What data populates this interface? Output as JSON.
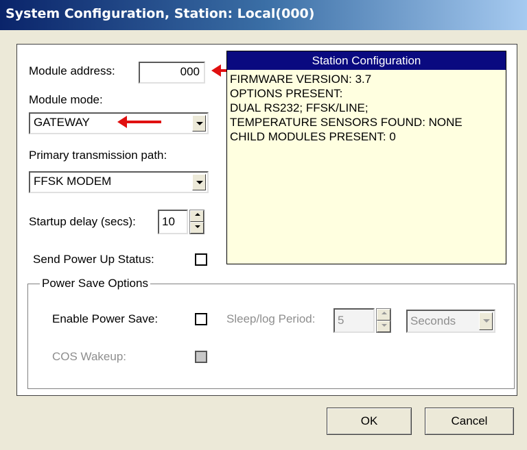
{
  "window": {
    "title": "System Configuration, Station: Local(000)"
  },
  "form": {
    "module_address_label": "Module address:",
    "module_address_value": "000",
    "module_mode_label": "Module mode:",
    "module_mode_value": "GATEWAY",
    "primary_path_label": "Primary transmission path:",
    "primary_path_value": "FFSK MODEM",
    "startup_delay_label": "Startup delay (secs):",
    "startup_delay_value": "10",
    "send_power_up_label": "Send Power Up Status:",
    "send_power_up_checked": false
  },
  "station_config": {
    "title": "Station Configuration",
    "lines": [
      "FIRMWARE VERSION: 3.7",
      "OPTIONS PRESENT:",
      "DUAL RS232; FFSK/LINE;",
      "TEMPERATURE SENSORS FOUND:  NONE",
      "CHILD MODULES PRESENT: 0"
    ]
  },
  "power_save": {
    "group_title": "Power Save Options",
    "enable_label": "Enable Power Save:",
    "enable_checked": false,
    "sleep_label": "Sleep/log Period:",
    "sleep_value": "5",
    "sleep_unit": "Seconds",
    "cos_label": "COS Wakeup:",
    "cos_checked": false
  },
  "buttons": {
    "ok": "OK",
    "cancel": "Cancel"
  },
  "colors": {
    "annotation_arrow": "#e01010",
    "config_header": "#0a0a80",
    "config_background": "#ffffe0"
  }
}
